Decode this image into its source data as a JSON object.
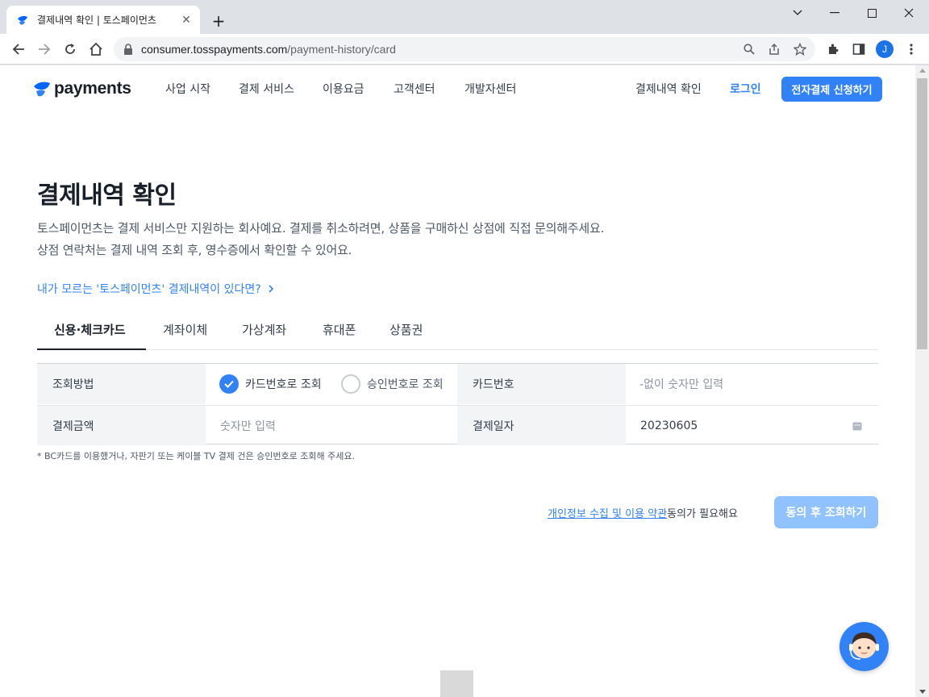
{
  "browser": {
    "tab_title": "결제내역 확인 | 토스페이먼츠",
    "url_host": "consumer.tosspayments.com",
    "url_path": "/payment-history/card",
    "profile_initial": "J"
  },
  "header": {
    "logo_text": "payments",
    "nav": [
      "사업 시작",
      "결제 서비스",
      "이용요금",
      "고객센터",
      "개발자센터"
    ],
    "history_link": "결제내역 확인",
    "login_link": "로그인",
    "apply_button": "전자결제 신청하기"
  },
  "main": {
    "title": "결제내역 확인",
    "desc_line1": "토스페이먼츠는 결제 서비스만 지원하는 회사예요. 결제를 취소하려면, 상품을 구매하신 상점에 직접 문의해주세요.",
    "desc_line2": "상점 연락처는 결제 내역 조회 후, 영수증에서 확인할 수 있어요.",
    "unknown_link": "내가 모르는 '토스페이먼츠' 결제내역이 있다면?",
    "tabs": [
      {
        "label": "신용·체크카드",
        "active": true
      },
      {
        "label": "계좌이체",
        "active": false
      },
      {
        "label": "가상계좌",
        "active": false
      },
      {
        "label": "휴대폰",
        "active": false
      },
      {
        "label": "상품권",
        "active": false
      }
    ]
  },
  "form": {
    "method_label": "조회방법",
    "option_card": "카드번호로 조회",
    "option_approval": "승인번호로 조회",
    "selected_option": "카드번호로 조회",
    "card_number_label": "카드번호",
    "card_number_placeholder": "-없이 숫자만 입력",
    "amount_label": "결제금액",
    "amount_placeholder": "숫자만 입력",
    "date_label": "결제일자",
    "date_value": "20230605",
    "note": "* BC카드를 이용했거나, 자판기 또는 케이블 TV 결제 건은 승인번호로 조회해 주세요."
  },
  "footer_action": {
    "terms_link": "개인정보 수집 및 이용 약관",
    "terms_suffix": "동의가 필요해요",
    "submit_button": "동의 후 조회하기"
  },
  "colors": {
    "brand_blue": "#3182f6",
    "disabled_blue": "#90c2ff",
    "label_bg": "#f2f4f6"
  }
}
